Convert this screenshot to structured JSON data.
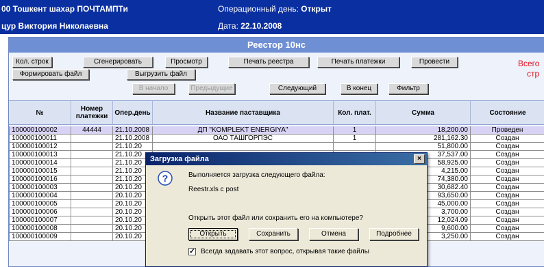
{
  "header": {
    "org": "00 Тошкент шахар ПОЧТАМПТи",
    "user": "цур Виктория Николаевна",
    "op_day_label": "Операционный день:",
    "op_day_value": "Открыт",
    "date_label": "Дата:",
    "date_value": "22.10.2008"
  },
  "panel": {
    "title": "Реестор 10нс",
    "total_line1": "Всего",
    "total_line2": "стр"
  },
  "toolbar": {
    "row1": [
      "Кол. строк",
      "Сгенерировать",
      "Просмотр",
      "Печать реестра",
      "Печать платежки",
      "Провести"
    ],
    "row2": [
      "Формировать файл",
      "Выгрузить файл"
    ],
    "nav": [
      "В начало",
      "Предыдущие",
      "Следующий",
      "В конец",
      "Фильтр"
    ]
  },
  "table": {
    "headers": [
      "№",
      "Номер платежки",
      "Опер.день",
      "Название паставщика",
      "Кол. плат.",
      "Сумма",
      "Состояние"
    ],
    "rows": [
      [
        "100000100002",
        "44444",
        "21.10.2008",
        "ДП \"KOMPLEKT ENERGIYA\"",
        "1",
        "18,200.00",
        "Проведен"
      ],
      [
        "100000100011",
        "",
        "21.10.2008",
        "ОАО ТАШГОРПЭС",
        "1",
        "281,162.30",
        "Создан"
      ],
      [
        "100000100012",
        "",
        "21.10.20",
        "",
        "",
        "51,800.00",
        "Создан"
      ],
      [
        "100000100013",
        "",
        "21.10.20",
        "",
        "",
        "37,537.00",
        "Создан"
      ],
      [
        "100000100014",
        "",
        "21.10.20",
        "",
        "",
        "58,925.00",
        "Создан"
      ],
      [
        "100000100015",
        "",
        "21.10.20",
        "",
        "",
        "4,215.00",
        "Создан"
      ],
      [
        "100000100016",
        "",
        "21.10.20",
        "",
        "",
        "74,380.00",
        "Создан"
      ],
      [
        "100000100003",
        "",
        "20.10.20",
        "",
        "",
        "30,682.40",
        "Создан"
      ],
      [
        "100000100004",
        "",
        "20.10.20",
        "",
        "",
        "93,650.00",
        "Создан"
      ],
      [
        "100000100005",
        "",
        "20.10.20",
        "",
        "",
        "45,000.00",
        "Создан"
      ],
      [
        "100000100006",
        "",
        "20.10.20",
        "",
        "",
        "3,700.00",
        "Создан"
      ],
      [
        "100000100007",
        "",
        "20.10.20",
        "",
        "",
        "12,024.09",
        "Создан"
      ],
      [
        "100000100008",
        "",
        "20.10.20",
        "",
        "",
        "9,600.00",
        "Создан"
      ],
      [
        "100000100009",
        "",
        "20.10.20",
        "",
        "",
        "3,250.00",
        "Создан"
      ]
    ]
  },
  "dialog": {
    "title": "Загрузка файла",
    "close": "×",
    "message": "Выполняется загрузка следующего файла:",
    "filename": "Reestr.xls с post",
    "question": "Открыть этот файл или сохранить его на компьютере?",
    "buttons": [
      "Открыть",
      "Сохранить",
      "Отмена",
      "Подробнее"
    ],
    "checkbox_checked": true,
    "checkbox_mark": "✓",
    "checkbox_label": "Всегда задавать этот вопрос, открывая такие файлы"
  },
  "colors": {
    "header_bg": "#0a2fa0",
    "panel_title_bg": "#6f8fd4",
    "selected_row": "#d8d3f5",
    "total_text": "#e01020"
  }
}
